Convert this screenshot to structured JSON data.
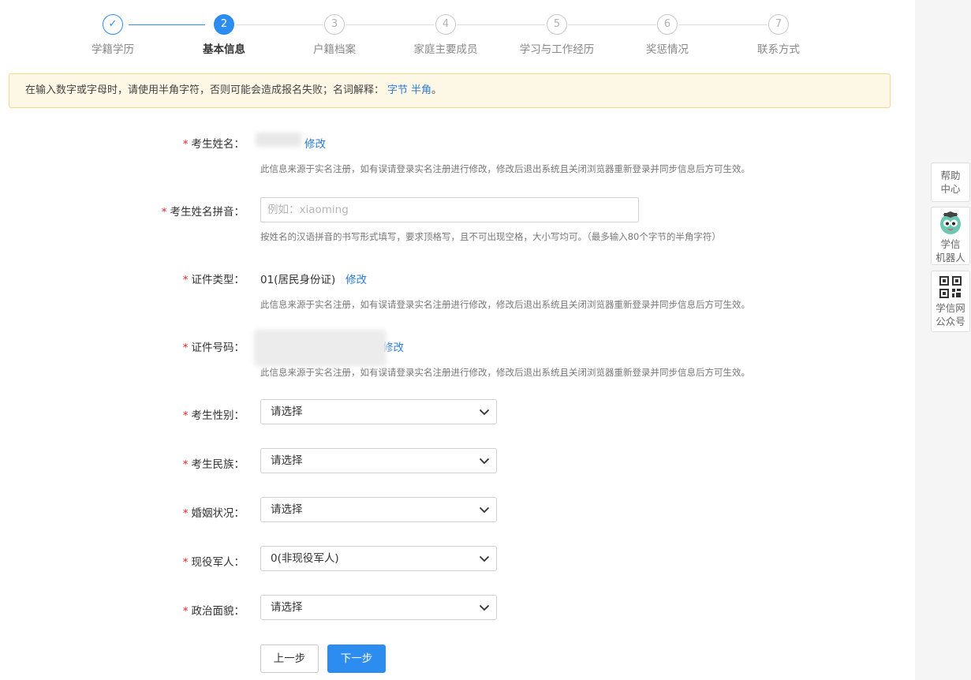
{
  "steps": [
    {
      "num": "✓",
      "label": "学籍学历",
      "state": "done"
    },
    {
      "num": "2",
      "label": "基本信息",
      "state": "active"
    },
    {
      "num": "3",
      "label": "户籍档案",
      "state": "todo"
    },
    {
      "num": "4",
      "label": "家庭主要成员",
      "state": "todo"
    },
    {
      "num": "5",
      "label": "学习与工作经历",
      "state": "todo"
    },
    {
      "num": "6",
      "label": "奖惩情况",
      "state": "todo"
    },
    {
      "num": "7",
      "label": "联系方式",
      "state": "todo"
    }
  ],
  "notice": {
    "text": "在输入数字或字母时，请使用半角字符，否则可能会造成报名失败；名词解释：",
    "link1": "字节",
    "link2": "半角",
    "end": "。"
  },
  "form": {
    "name": {
      "label": "考生姓名：",
      "edit": "修改",
      "hint": "此信息来源于实名注册，如有误请登录实名注册进行修改，修改后退出系统且关闭浏览器重新登录并同步信息后方可生效。"
    },
    "pinyin": {
      "label": "考生姓名拼音：",
      "placeholder": "例如：xiaoming",
      "hint": "按姓名的汉语拼音的书写形式填写，要求顶格写，且不可出现空格，大小写均可。（最多输入80个字节的半角字符）"
    },
    "id_type": {
      "label": "证件类型：",
      "value": "01(居民身份证)",
      "edit": "修改",
      "hint": "此信息来源于实名注册，如有误请登录实名注册进行修改，修改后退出系统且关闭浏览器重新登录并同步信息后方可生效。"
    },
    "id_number": {
      "label": "证件号码：",
      "edit": "修改",
      "hint": "此信息来源于实名注册，如有误请登录实名注册进行修改，修改后退出系统且关闭浏览器重新登录并同步信息后方可生效。"
    },
    "gender": {
      "label": "考生性别：",
      "value": "请选择"
    },
    "ethnicity": {
      "label": "考生民族：",
      "value": "请选择"
    },
    "marital": {
      "label": "婚姻状况：",
      "value": "请选择"
    },
    "military": {
      "label": "现役军人：",
      "value": "0(非现役军人)"
    },
    "political": {
      "label": "政治面貌：",
      "value": "请选择"
    }
  },
  "buttons": {
    "prev": "上一步",
    "next": "下一步"
  },
  "side": {
    "help": [
      "帮助",
      "中心"
    ],
    "robot": [
      "学信",
      "机器人"
    ],
    "wechat": [
      "学信网",
      "公众号"
    ]
  },
  "colors": {
    "primary": "#2d8cf0",
    "required": "#e02020",
    "link": "#2d7cd8",
    "notice_bg": "#fdf7e5"
  }
}
